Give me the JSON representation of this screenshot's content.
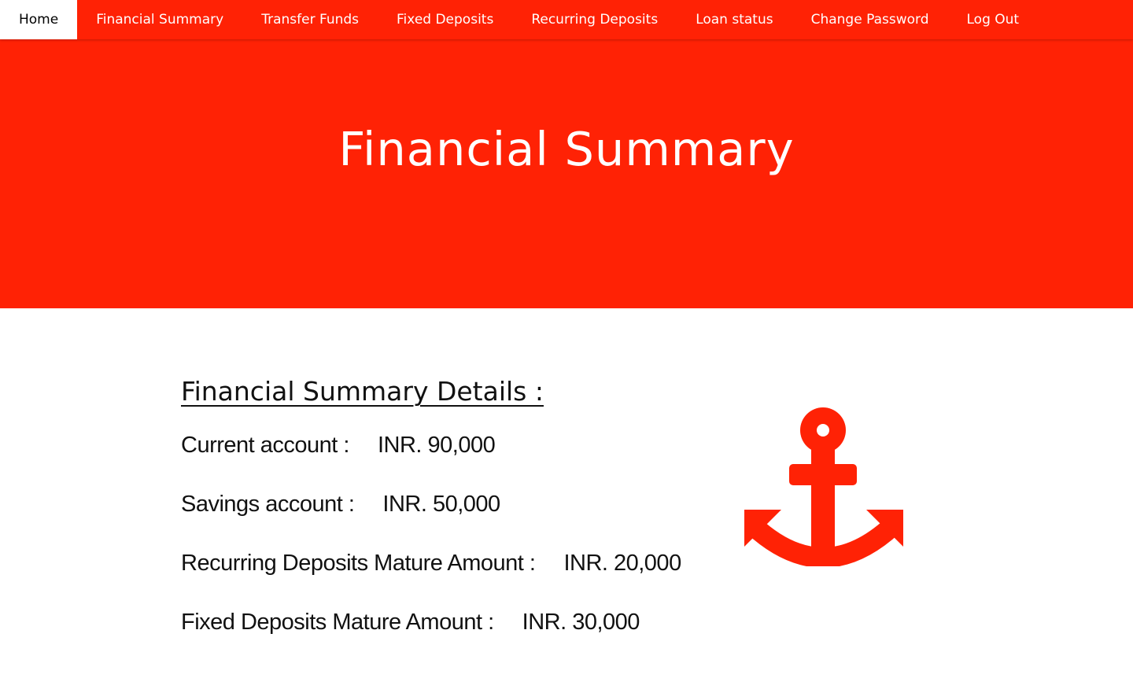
{
  "navbar": {
    "items": [
      {
        "label": "Home",
        "active": true
      },
      {
        "label": "Financial Summary"
      },
      {
        "label": "Transfer Funds"
      },
      {
        "label": "Fixed Deposits"
      },
      {
        "label": "Recurring Deposits"
      },
      {
        "label": "Loan status"
      },
      {
        "label": "Change Password"
      },
      {
        "label": "Log Out"
      }
    ]
  },
  "hero": {
    "title": "Financial Summary"
  },
  "details": {
    "heading": "Financial Summary Details :",
    "rows": [
      {
        "label": "Current account :",
        "value": "INR. 90,000"
      },
      {
        "label": "Savings account :",
        "value": "INR. 50,000"
      },
      {
        "label": "Recurring Deposits Mature Amount :",
        "value": "INR. 20,000"
      },
      {
        "label": "Fixed Deposits Mature Amount :",
        "value": "INR. 30,000"
      }
    ]
  },
  "icons": {
    "illustration": "anchor-icon"
  },
  "colors": {
    "accent": "#ff2205",
    "text": "#111111",
    "background": "#ffffff"
  }
}
